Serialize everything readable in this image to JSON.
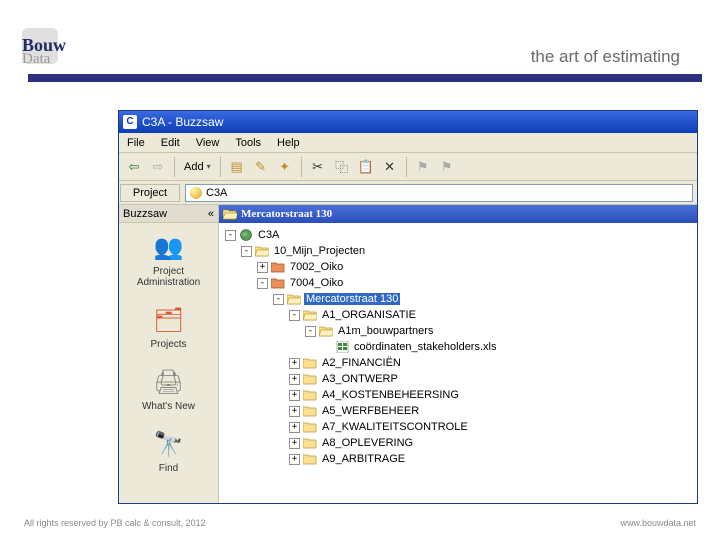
{
  "header": {
    "logo1": "Bouw",
    "logo2": "Data",
    "tagline": "the art of estimating"
  },
  "app": {
    "title": "C3A - Buzzsaw",
    "menu": [
      "File",
      "Edit",
      "View",
      "Tools",
      "Help"
    ],
    "toolbar": {
      "add": "Add"
    },
    "projectbar": {
      "label": "Project",
      "value": "C3A"
    },
    "sidebar": {
      "title": "Buzzsaw",
      "collapse": "«",
      "items": [
        {
          "label": "Project Administration"
        },
        {
          "label": "Projects"
        },
        {
          "label": "What's New"
        },
        {
          "label": "Find"
        }
      ]
    },
    "tree": {
      "header": "Mercatorstraat 130",
      "root": "C3A",
      "nodes": {
        "n1": "10_Mijn_Projecten",
        "n2": "7002_Oiko",
        "n3": "7004_Oiko",
        "n4": "Mercatorstraat 130",
        "n5": "A1_ORGANISATIE",
        "n6": "A1m_bouwpartners",
        "n7": "coördinaten_stakeholders.xls",
        "n8": "A2_FINANCIËN",
        "n9": "A3_ONTWERP",
        "n10": "A4_KOSTENBEHEERSING",
        "n11": "A5_WERFBEHEER",
        "n12": "A7_KWALITEITSCONTROLE",
        "n13": "A8_OPLEVERING",
        "n14": "A9_ARBITRAGE"
      }
    }
  },
  "footer": {
    "left": "All rights reserved by PB calc & consult, 2012",
    "right": "www.bouwdata.net"
  }
}
